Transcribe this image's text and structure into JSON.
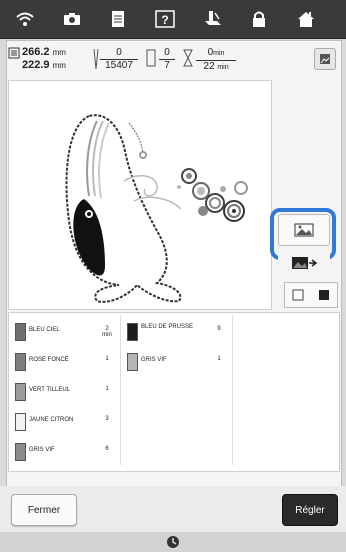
{
  "top_toolbar": {
    "icons": [
      "wifi-icon",
      "camera-icon",
      "document-icon",
      "help-icon",
      "embroidery-icon",
      "lock-icon",
      "home-icon"
    ]
  },
  "info": {
    "width": "266.2",
    "height": "222.9",
    "unit": "mm",
    "stitch_current": "0",
    "stitch_total": "15407",
    "color_current": "0",
    "color_total": "7",
    "time_current": "0",
    "time_total": "22",
    "time_unit": "min"
  },
  "threads": {
    "col1": [
      {
        "name": "BLEU CIEL",
        "count": "2",
        "unit": "min",
        "color": "#6f6f6f"
      },
      {
        "name": "ROSE FONCÉ",
        "count": "1",
        "unit": "",
        "color": "#7d7d7d"
      },
      {
        "name": "VERT TILLEUL",
        "count": "1",
        "unit": "",
        "color": "#9a9a9a"
      },
      {
        "name": "JAUNE CITRON",
        "count": "3",
        "unit": "",
        "color": "#f2f2f2"
      },
      {
        "name": "GRIS VIF",
        "count": "6",
        "unit": "",
        "color": "#8c8c8c"
      }
    ],
    "col2": [
      {
        "name": "BLEU DE PRUSSE",
        "count": "9",
        "unit": "",
        "color": "#1c1c1c"
      },
      {
        "name": "GRIS VIF",
        "count": "1",
        "unit": "",
        "color": "#b5b5b5"
      }
    ]
  },
  "buttons": {
    "close": "Fermer",
    "set": "Régler"
  },
  "colors": {
    "highlight": "#2f79d8",
    "toolbar_bg": "#3a3a3a"
  }
}
